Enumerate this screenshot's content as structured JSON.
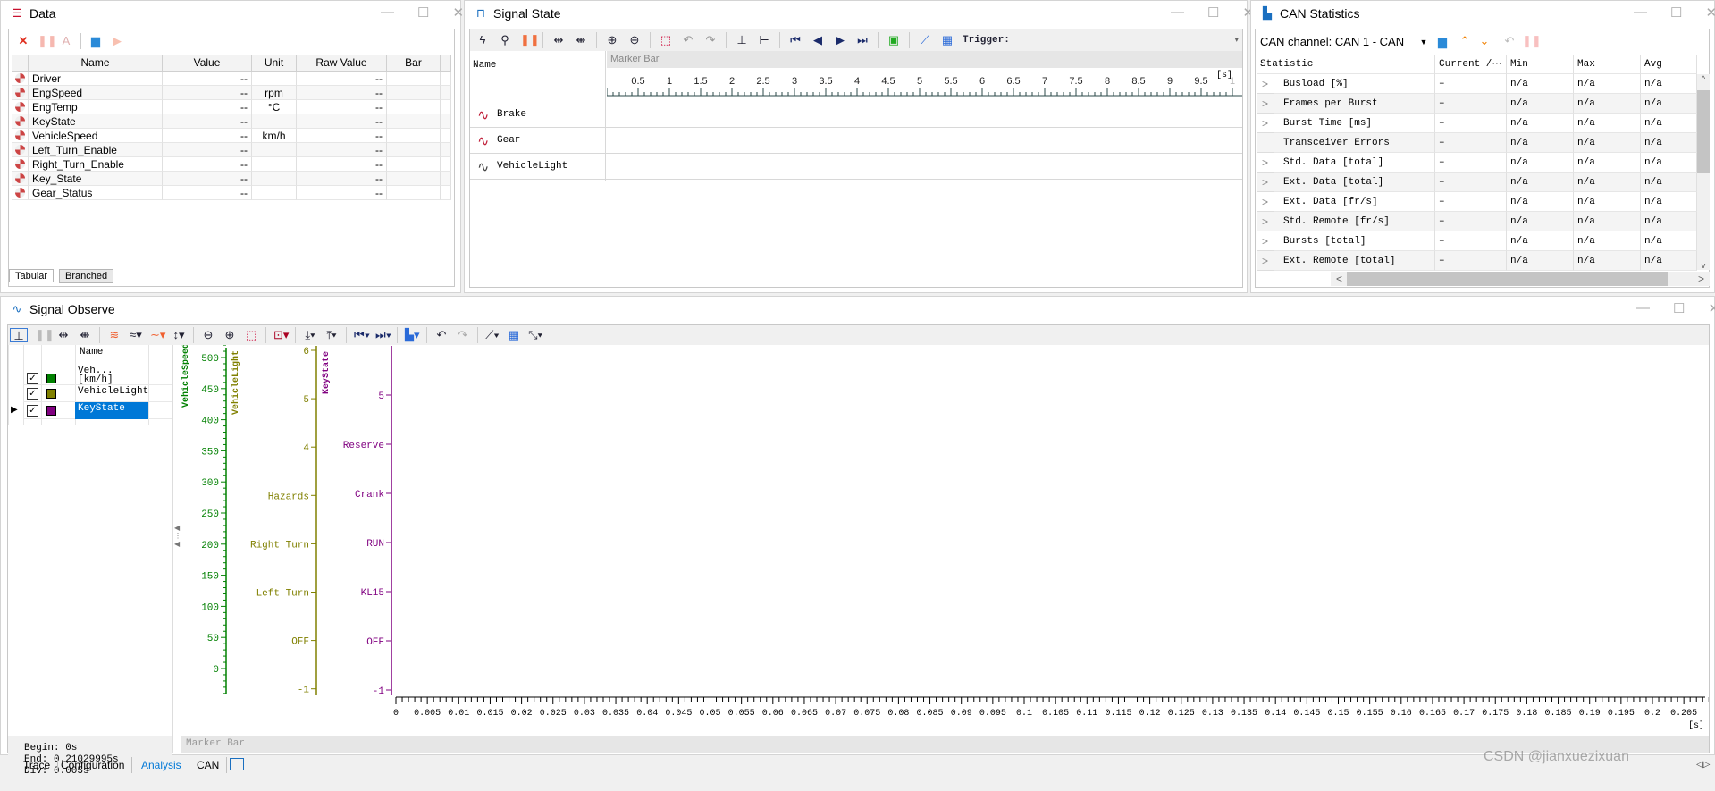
{
  "colors": {
    "accent": "#0078d7",
    "speed": "#008000",
    "light": "#808000",
    "key": "#800080"
  },
  "data_panel": {
    "title": "Data",
    "toolbar": [
      "delete-icon",
      "pause-icon",
      "font-icon",
      "folder-icon",
      "play-icon"
    ],
    "columns": [
      "Name",
      "Value",
      "Unit",
      "Raw Value",
      "Bar"
    ],
    "rows": [
      {
        "name": "Driver",
        "value": "--",
        "unit": "",
        "raw": "--"
      },
      {
        "name": "EngSpeed",
        "value": "--",
        "unit": "rpm",
        "raw": "--"
      },
      {
        "name": "EngTemp",
        "value": "--",
        "unit": "°C",
        "raw": "--"
      },
      {
        "name": "KeyState",
        "value": "--",
        "unit": "",
        "raw": "--"
      },
      {
        "name": "VehicleSpeed",
        "value": "--",
        "unit": "km/h",
        "raw": "--"
      },
      {
        "name": "Left_Turn_Enable",
        "value": "--",
        "unit": "",
        "raw": "--"
      },
      {
        "name": "Right_Turn_Enable",
        "value": "--",
        "unit": "",
        "raw": "--"
      },
      {
        "name": "Key_State",
        "value": "--",
        "unit": "",
        "raw": "--"
      },
      {
        "name": "Gear_Status",
        "value": "--",
        "unit": "",
        "raw": "--"
      }
    ],
    "tabs": [
      "Tabular",
      "Branched"
    ]
  },
  "signal_state": {
    "title": "Signal State",
    "trigger_label": "Trigger:",
    "name_header": "Name",
    "marker_bar": "Marker Bar",
    "ruler_labels": [
      "0.5",
      "1",
      "1.5",
      "2",
      "2.5",
      "3",
      "3.5",
      "4",
      "4.5",
      "5",
      "5.5",
      "6",
      "6.5",
      "7",
      "7.5",
      "8",
      "8.5",
      "9",
      "9.5",
      "1"
    ],
    "ruler_unit": "[s]",
    "signals": [
      "Brake",
      "Gear",
      "VehicleLight"
    ]
  },
  "can_stats": {
    "title": "CAN Statistics",
    "channel_label": "CAN channel: CAN 1 - CAN",
    "columns": [
      "Statistic",
      "Current /⋯",
      "Min",
      "Max",
      "Avg"
    ],
    "rows": [
      {
        "name": "Busload [%]",
        "exp": true,
        "cur": "–",
        "min": "n/a",
        "max": "n/a",
        "avg": "n/a"
      },
      {
        "name": "Frames per Burst",
        "exp": true,
        "cur": "–",
        "min": "n/a",
        "max": "n/a",
        "avg": "n/a"
      },
      {
        "name": "Burst Time [ms]",
        "exp": true,
        "cur": "–",
        "min": "n/a",
        "max": "n/a",
        "avg": "n/a"
      },
      {
        "name": "Transceiver Errors",
        "exp": false,
        "cur": "–",
        "min": "n/a",
        "max": "n/a",
        "avg": "n/a"
      },
      {
        "name": "Std. Data [total]",
        "exp": true,
        "cur": "–",
        "min": "n/a",
        "max": "n/a",
        "avg": "n/a"
      },
      {
        "name": "Ext. Data [total]",
        "exp": true,
        "cur": "–",
        "min": "n/a",
        "max": "n/a",
        "avg": "n/a"
      },
      {
        "name": "Ext. Data [fr/s]",
        "exp": true,
        "cur": "–",
        "min": "n/a",
        "max": "n/a",
        "avg": "n/a"
      },
      {
        "name": "Std. Remote [fr/s]",
        "exp": true,
        "cur": "–",
        "min": "n/a",
        "max": "n/a",
        "avg": "n/a"
      },
      {
        "name": "Bursts [total]",
        "exp": true,
        "cur": "–",
        "min": "n/a",
        "max": "n/a",
        "avg": "n/a"
      },
      {
        "name": "Ext. Remote [total]",
        "exp": true,
        "cur": "–",
        "min": "n/a",
        "max": "n/a",
        "avg": "n/a"
      }
    ]
  },
  "signal_observe": {
    "title": "Signal Observe",
    "list_header": "Name",
    "signals": [
      {
        "name": "Veh...",
        "unit": "[km/h]",
        "color": "#008000",
        "checked": true,
        "selected": false
      },
      {
        "name": "VehicleLight",
        "unit": "",
        "color": "#808000",
        "checked": true,
        "selected": false
      },
      {
        "name": "KeyState",
        "unit": "",
        "color": "#800080",
        "checked": true,
        "selected": true
      }
    ],
    "begin": "Begin: 0s",
    "end": "End: 0.21029995s",
    "div": "Div: 0.005s",
    "marker_bar": "Marker Bar",
    "axes": {
      "speed": {
        "title": "VehicleSpeed",
        "labels": [
          "0",
          "50",
          "100",
          "150",
          "200",
          "250",
          "300",
          "350",
          "400",
          "450",
          "500"
        ]
      },
      "light": {
        "title": "VehicleLight",
        "labels": [
          "-1",
          "OFF",
          "Left Turn",
          "Right Turn",
          "Hazards",
          "4",
          "5",
          "6"
        ]
      },
      "key": {
        "title": "KeyState",
        "labels": [
          "-1",
          "OFF",
          "KL15",
          "RUN",
          "Crank",
          "Reserve",
          "5"
        ]
      }
    },
    "time_labels": [
      "0",
      "0.005",
      "0.01",
      "0.015",
      "0.02",
      "0.025",
      "0.03",
      "0.035",
      "0.04",
      "0.045",
      "0.05",
      "0.055",
      "0.06",
      "0.065",
      "0.07",
      "0.075",
      "0.08",
      "0.085",
      "0.09",
      "0.095",
      "0.1",
      "0.105",
      "0.11",
      "0.115",
      "0.12",
      "0.125",
      "0.13",
      "0.135",
      "0.14",
      "0.145",
      "0.15",
      "0.155",
      "0.16",
      "0.165",
      "0.17",
      "0.175",
      "0.18",
      "0.185",
      "0.19",
      "0.195",
      "0.2",
      "0.205"
    ],
    "time_unit": "[s]"
  },
  "bottom_tabs": [
    {
      "label": "Trace",
      "active": false
    },
    {
      "label": "Configuration",
      "active": false
    },
    {
      "label": "Analysis",
      "active": true
    },
    {
      "label": "CAN",
      "active": false
    }
  ],
  "watermark": "CSDN @jianxuezixuan"
}
